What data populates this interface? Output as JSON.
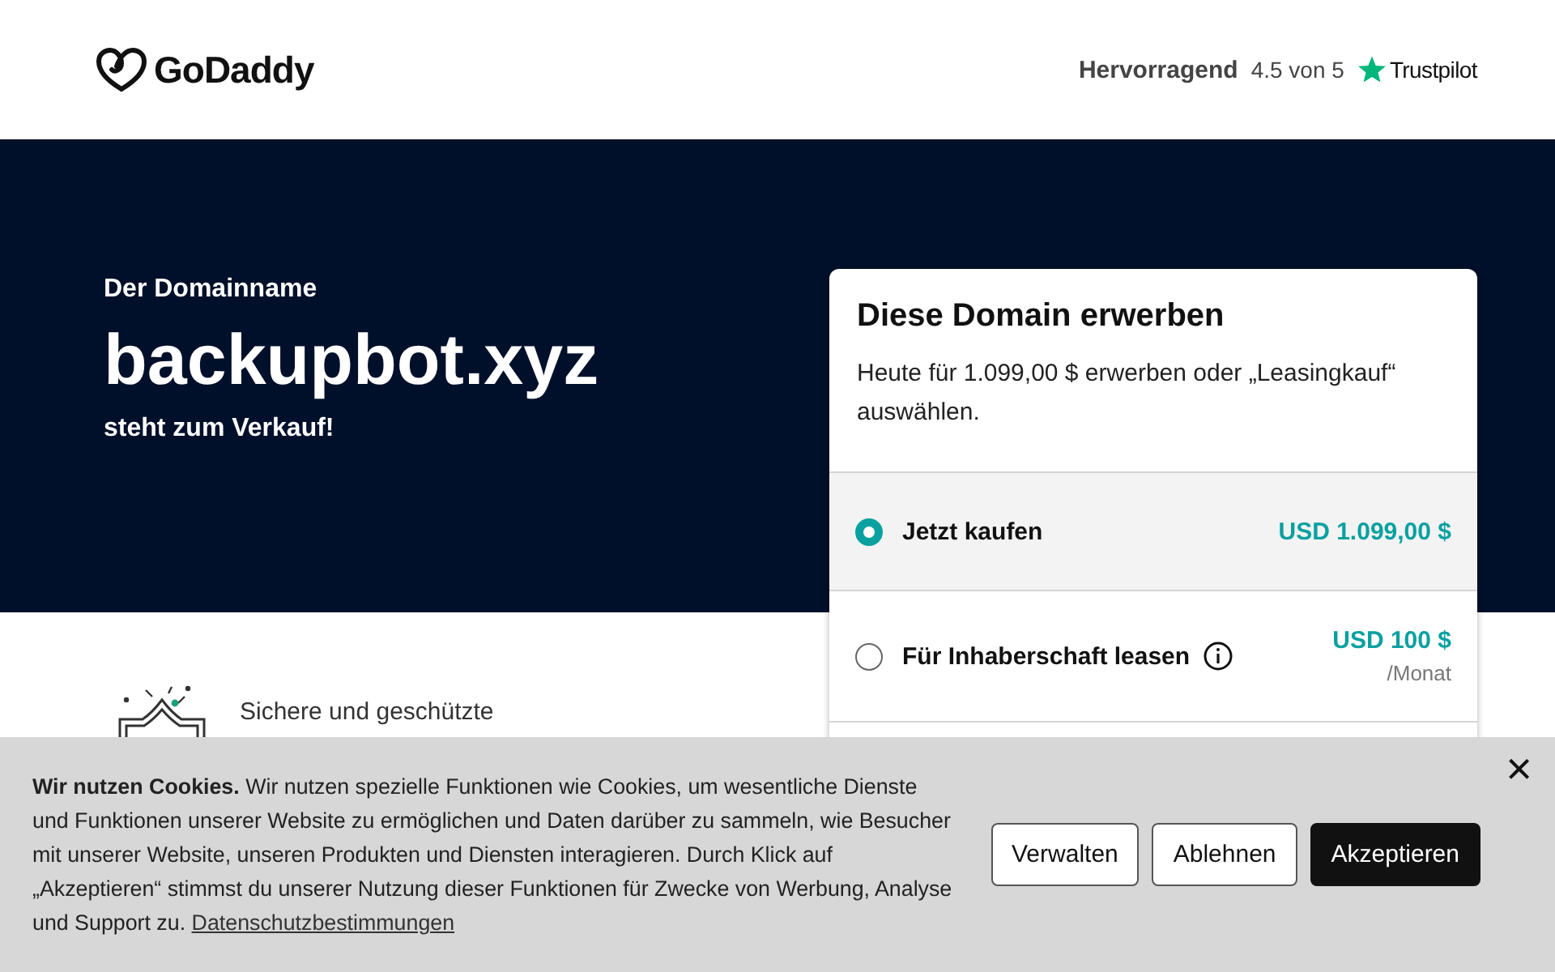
{
  "header": {
    "logo": "GoDaddy",
    "rating_label": "Hervorragend",
    "rating_score": "4.5 von 5",
    "trustpilot": "Trustpilot"
  },
  "hero": {
    "eyebrow": "Der Domainname",
    "domain": "backupbot.xyz",
    "subtitle": "steht zum Verkauf!"
  },
  "purchase_card": {
    "title": "Diese Domain erwerben",
    "description": "Heute für 1.099,00 $ erwerben oder „Leasingkauf“ auswählen.",
    "options": [
      {
        "label": "Jetzt kaufen",
        "price": "USD 1.099,00 $",
        "selected": true,
        "info": false
      },
      {
        "label": "Für Inhaberschaft leasen",
        "price": "USD 100 $",
        "period": "/Monat",
        "selected": false,
        "info": true
      }
    ]
  },
  "features": [
    {
      "text": "Sichere und geschützte"
    }
  ],
  "cookie_banner": {
    "text": "**Wir nutzen Cookies.** Wir nutzen spezielle Funktionen wie Cookies, um wesentliche Dienste und Funktionen unserer Website zu ermöglichen und Daten darüber zu sammeln, wie Besucher mit unserer Website, unseren Produkten und Diensten interagieren. Durch Klick auf „Akzeptieren“ stimmst du unserer Nutzung dieser Funktionen für Zwecke von Werbung, Analyse und Support zu.",
    "link": "Datenschutzbestimmungen",
    "buttons": [
      {
        "label": "Verwalten",
        "kind": "outline"
      },
      {
        "label": "Ablehnen",
        "kind": "outline"
      },
      {
        "label": "Akzeptieren",
        "kind": "primary"
      }
    ],
    "close": "×"
  }
}
